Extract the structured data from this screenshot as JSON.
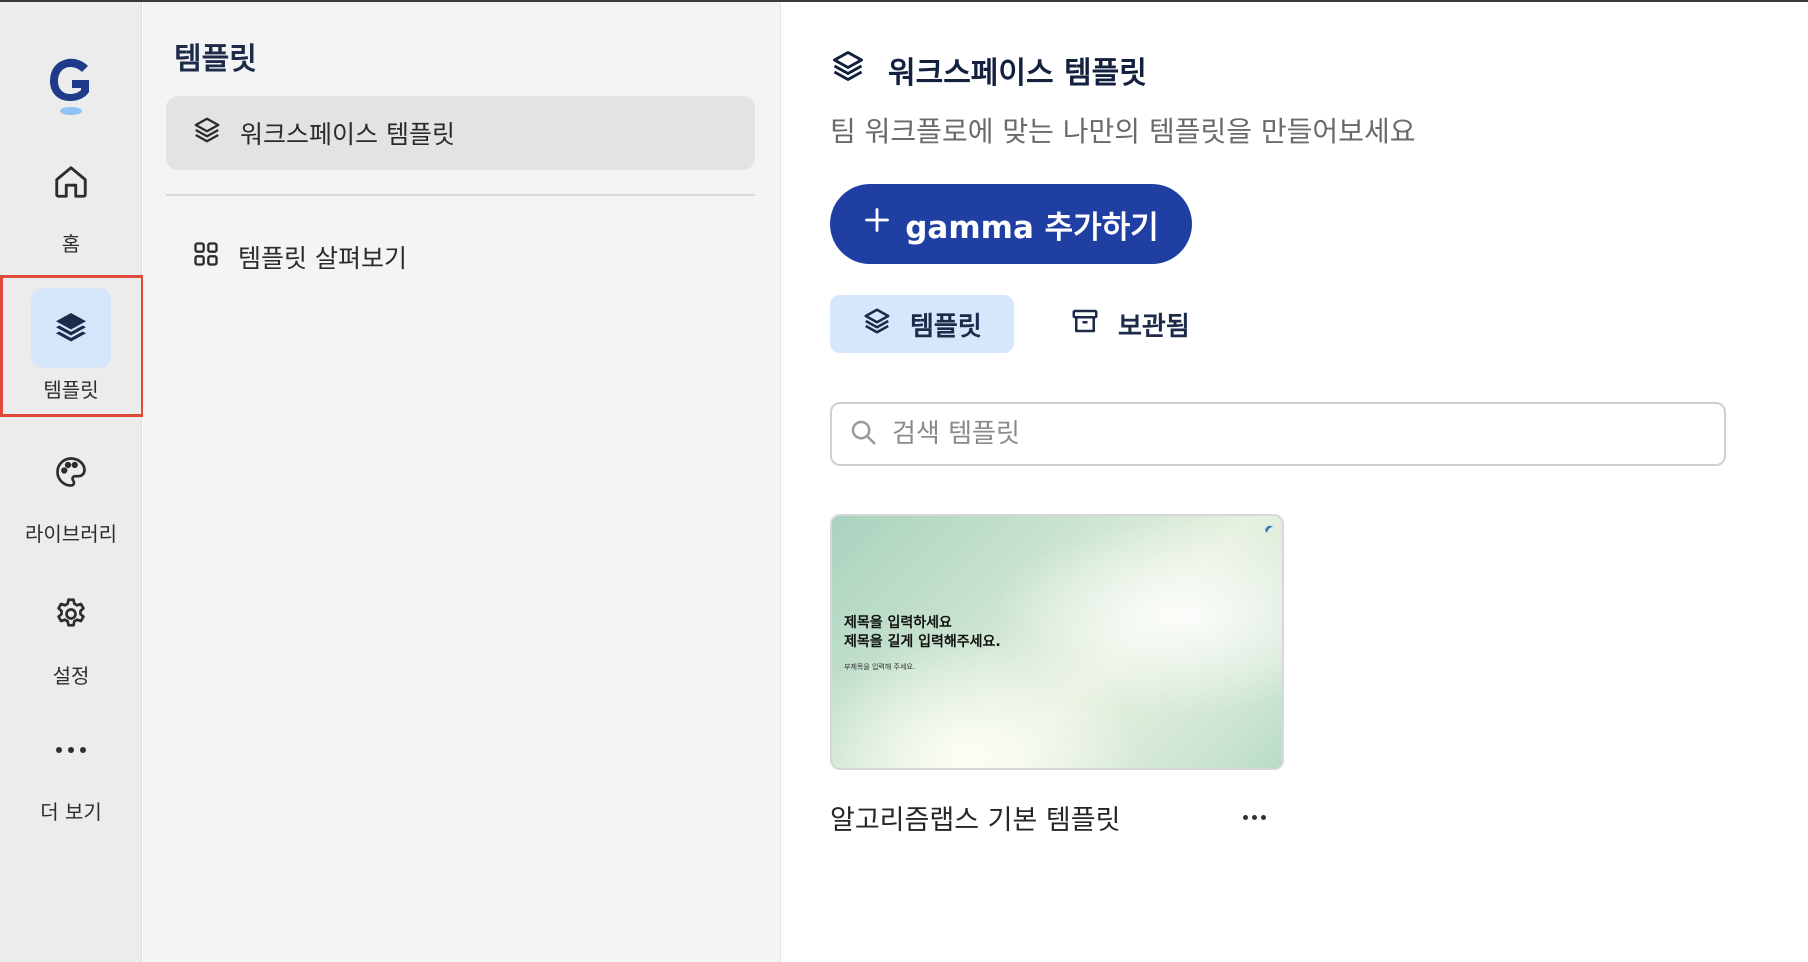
{
  "rail": {
    "items": [
      {
        "label": "홈",
        "icon": "home-icon"
      },
      {
        "label": "템플릿",
        "icon": "layers-icon"
      },
      {
        "label": "라이브러리",
        "icon": "palette-icon"
      },
      {
        "label": "설정",
        "icon": "gear-icon"
      },
      {
        "label": "더 보기",
        "icon": "more-horizontal-icon"
      }
    ],
    "active_color": "#d5e6fb",
    "highlight_color": "#e04a3a"
  },
  "sidebar": {
    "title": "템플릿",
    "items": [
      {
        "label": "워크스페이스 템플릿",
        "icon": "layers-icon"
      },
      {
        "label": "템플릿 살펴보기",
        "icon": "grid-icon"
      }
    ]
  },
  "main": {
    "title": "워크스페이스 템플릿",
    "subtitle": "팀 워크플로에 맞는 나만의 템플릿을 만들어보세요",
    "add_button_label": "gamma 추가하기",
    "add_button_color": "#1f3fa3",
    "tabs": [
      {
        "label": "템플릿",
        "icon": "layers-icon"
      },
      {
        "label": "보관됨",
        "icon": "archive-icon"
      }
    ],
    "search": {
      "placeholder": "검색 템플릿",
      "value": ""
    },
    "templates": [
      {
        "name": "알고리즘랩스 기본 템플릿",
        "thumbnail": {
          "title_line1": "제목을 입력하세요",
          "title_line2": "제목을 길게 입력해주세요.",
          "subtitle": "부제목을 입력해 주세요."
        }
      }
    ]
  }
}
